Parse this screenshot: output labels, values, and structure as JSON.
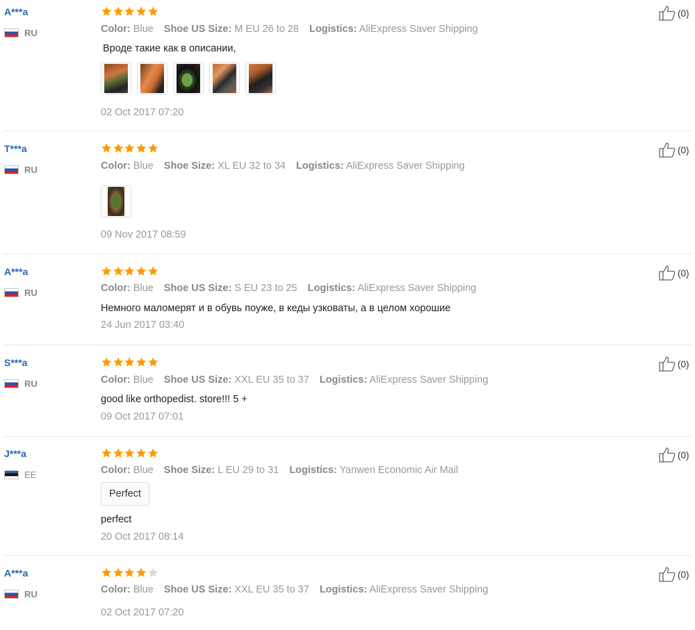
{
  "colors": {
    "star_filled": "#ff9a00",
    "star_empty": "#d9d9d9",
    "username": "#2a64b0",
    "meta": "#999999"
  },
  "attr_labels": {
    "color": "Color:",
    "shoe_us_size": "Shoe US Size:",
    "shoe_size": "Shoe Size:",
    "logistics": "Logistics:"
  },
  "reviews": [
    {
      "user": "A***a",
      "country": "RU",
      "flag": "russia-flag",
      "rating": 5,
      "attrs": [
        {
          "label": "Color:",
          "value": "Blue"
        },
        {
          "label": "Shoe US Size:",
          "value": "M EU 26 to 28"
        },
        {
          "label": "Logistics:",
          "value": "AliExpress Saver Shipping"
        }
      ],
      "text": "Вроде такие как в описании,",
      "photos": [
        "photo-1",
        "photo-2",
        "photo-3",
        "photo-4",
        "photo-5"
      ],
      "date": "02 Oct 2017 07:20",
      "likes": "(0)"
    },
    {
      "user": "T***a",
      "country": "RU",
      "flag": "russia-flag",
      "rating": 5,
      "attrs": [
        {
          "label": "Color:",
          "value": "Blue"
        },
        {
          "label": "Shoe Size:",
          "value": "XL EU 32 to 34"
        },
        {
          "label": "Logistics:",
          "value": "AliExpress Saver Shipping"
        }
      ],
      "text": "",
      "photos": [
        "photo-1"
      ],
      "date": "09 Nov 2017 08:59",
      "likes": "(0)"
    },
    {
      "user": "A***a",
      "country": "RU",
      "flag": "russia-flag",
      "rating": 5,
      "attrs": [
        {
          "label": "Color:",
          "value": "Blue"
        },
        {
          "label": "Shoe US Size:",
          "value": "S EU 23 to 25"
        },
        {
          "label": "Logistics:",
          "value": "AliExpress Saver Shipping"
        }
      ],
      "text": "Немного маломерят и в обувь поуже, в кеды узковаты, а в целом хорошие",
      "photos": [],
      "date": "24 Jun 2017 03:40",
      "likes": "(0)"
    },
    {
      "user": "S***a",
      "country": "RU",
      "flag": "russia-flag",
      "rating": 5,
      "attrs": [
        {
          "label": "Color:",
          "value": "Blue"
        },
        {
          "label": "Shoe US Size:",
          "value": "XXL EU 35 to 37"
        },
        {
          "label": "Logistics:",
          "value": "AliExpress Saver Shipping"
        }
      ],
      "text": "good like orthopedist. store!!! 5 +",
      "photos": [],
      "date": "09 Oct 2017 07:01",
      "likes": "(0)"
    },
    {
      "user": "J***a",
      "country": "EE",
      "flag": "estonia-flag",
      "rating": 5,
      "attrs": [
        {
          "label": "Color:",
          "value": "Blue"
        },
        {
          "label": "Shoe Size:",
          "value": "L EU 29 to 31"
        },
        {
          "label": "Logistics:",
          "value": "Yanwen Economic Air Mail"
        }
      ],
      "tag": "Perfect",
      "text": "perfect",
      "photos": [],
      "date": "20 Oct 2017 08:14",
      "likes": "(0)"
    },
    {
      "user": "A***a",
      "country": "RU",
      "flag": "russia-flag",
      "rating": 4,
      "attrs": [
        {
          "label": "Color:",
          "value": "Blue"
        },
        {
          "label": "Shoe US Size:",
          "value": "XXL EU 35 to 37"
        },
        {
          "label": "Logistics:",
          "value": "AliExpress Saver Shipping"
        }
      ],
      "text": "",
      "photos": [],
      "date": "02 Oct 2017 07:20",
      "likes": "(0)"
    }
  ]
}
